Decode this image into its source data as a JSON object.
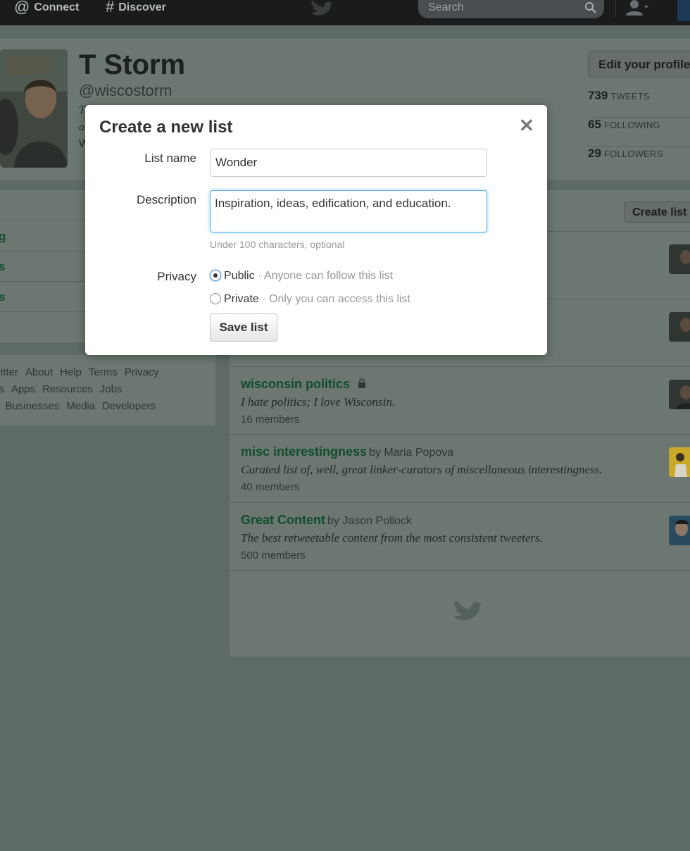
{
  "topbar": {
    "connect_label": "Connect",
    "discover_label": "Discover",
    "search_placeholder": "Search"
  },
  "profile": {
    "name": "T Storm",
    "handle": "@wiscostorm",
    "bio_fragments": [
      "T",
      "a",
      "W"
    ],
    "edit_label": "Edit your profile",
    "stats": [
      {
        "value": "739",
        "label": "TWEETS"
      },
      {
        "value": "65",
        "label": "FOLLOWING"
      },
      {
        "value": "29",
        "label": "FOLLOWERS"
      }
    ]
  },
  "sidebar": {
    "items": [
      "g",
      "s",
      "s"
    ],
    "footer_lines": [
      [
        "witter",
        "About",
        "Help",
        "Terms",
        "Privacy"
      ],
      [
        "us",
        "Apps",
        "Resources",
        "Jobs"
      ],
      [
        "s",
        "Businesses",
        "Media",
        "Developers"
      ]
    ]
  },
  "lists_panel": {
    "create_label": "Create list",
    "items": [
      {
        "name": "wisconsin politics",
        "by": "",
        "desc": "I hate politics; I love Wisconsin.",
        "members": "16 members"
      },
      {
        "name": "misc interestingness",
        "by": "by Maria Popova",
        "desc": "Curated list of, well, great linker-curators of miscellaneous interestingness.",
        "members": "40 members"
      },
      {
        "name": "Great Content",
        "by": "by Jason Pollock",
        "desc": "The best retweetable content from the most consistent tweeters.",
        "members": "500 members"
      }
    ]
  },
  "modal": {
    "title": "Create a new list",
    "close_glyph": "✕",
    "list_name_label": "List name",
    "list_name_value": "Wonder",
    "description_label": "Description",
    "description_value": "Inspiration, ideas, edification, and education.",
    "hint": "Under 100 characters, optional",
    "privacy_label": "Privacy",
    "public_label": "Public",
    "public_note": "· Anyone can follow this list",
    "private_label": "Private",
    "private_note": "· Only you can access this list",
    "selected_privacy": "Public",
    "save_label": "Save list"
  },
  "colors": {
    "overlay": "#5e6a64",
    "list_link": "#124d2b",
    "focus": "#56b4ef"
  }
}
